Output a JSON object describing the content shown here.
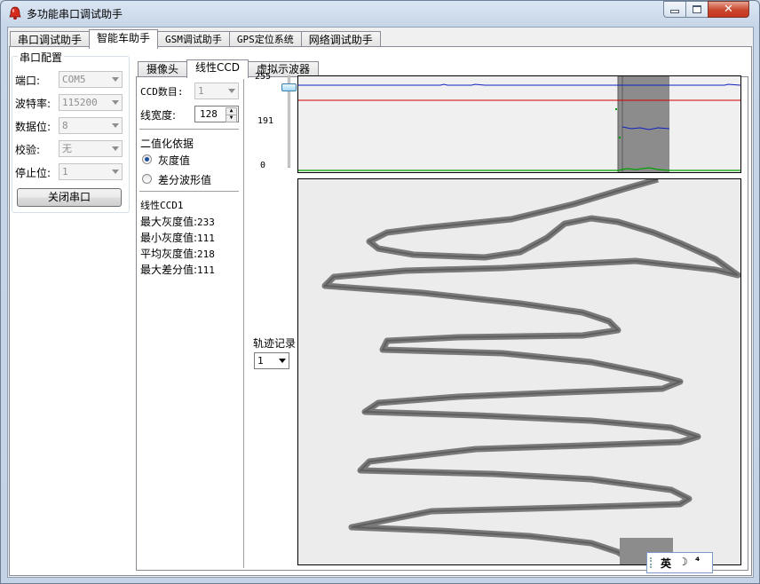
{
  "window": {
    "title": "多功能串口调试助手"
  },
  "tabs": [
    "串口调试助手",
    "智能车助手",
    "GSM调试助手",
    "GPS定位系统",
    "网络调试助手"
  ],
  "active_tab": 1,
  "serial_config": {
    "group_title": "串口配置",
    "port_label": "端口:",
    "port_value": "COM5",
    "baud_label": "波特率:",
    "baud_value": "115200",
    "databits_label": "数据位:",
    "databits_value": "8",
    "parity_label": "校验:",
    "parity_value": "无",
    "stopbits_label": "停止位:",
    "stopbits_value": "1",
    "close_button": "关闭串口"
  },
  "subtabs": [
    "摄像头",
    "线性CCD",
    "虚拟示波器"
  ],
  "active_subtab": 1,
  "ccd": {
    "count_label": "CCD数目:",
    "count_value": "1",
    "width_label": "线宽度:",
    "width_value": "128",
    "binarize_title": "二值化依据",
    "radio_gray": "灰度值",
    "radio_diff": "差分波形值",
    "stats_title": "线性CCD1",
    "max_gray_label": "最大灰度值:",
    "max_gray": "233",
    "min_gray_label": "最小灰度值:",
    "min_gray": "111",
    "avg_gray_label": "平均灰度值:",
    "avg_gray": "218",
    "max_diff_label": "最大差分值:",
    "max_diff": "111",
    "track_label": "轨迹记录",
    "track_value": "1"
  },
  "scale": {
    "top": "255",
    "mid": "191",
    "bottom": "0",
    "slider_level": 221
  },
  "ime": {
    "lang": "英"
  },
  "colors": {
    "threshold_line": "#d00000",
    "blue_trace": "#1020c0",
    "green_trace": "#00a000",
    "track_dark": "#7a7a7a",
    "track_bg": "#ececec"
  }
}
